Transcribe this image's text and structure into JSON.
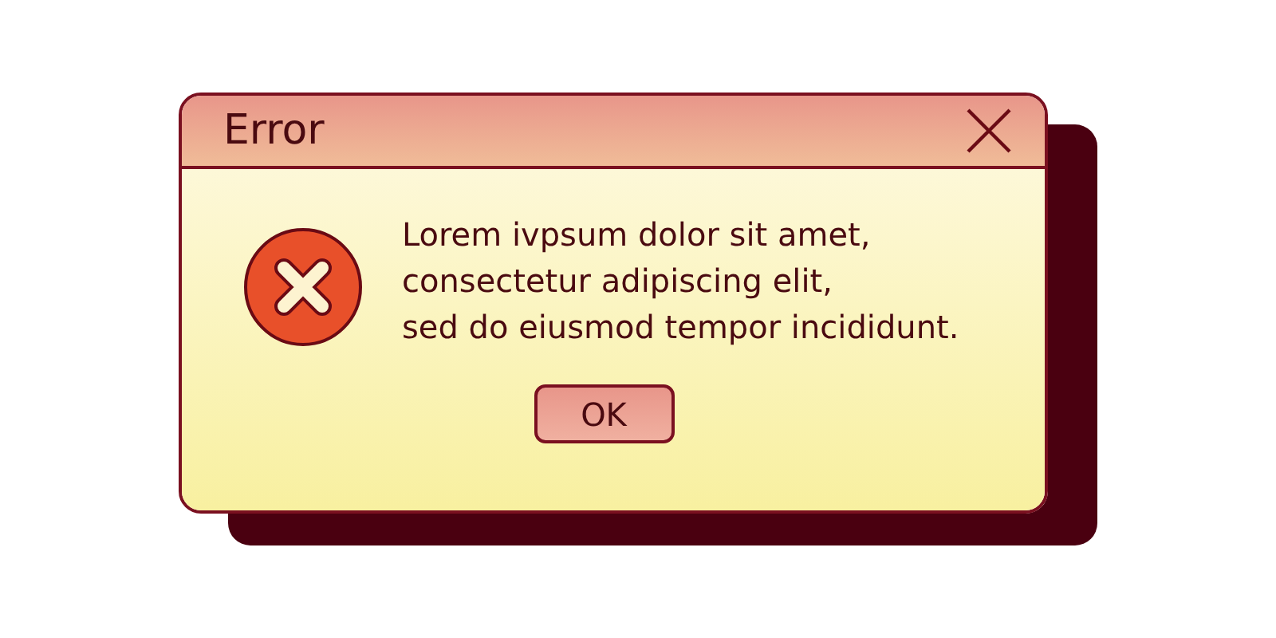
{
  "window": {
    "title": "Error"
  },
  "message": {
    "lines": [
      "Lorem ivpsum dolor sit amet,",
      "consectetur adipiscing elit,",
      "sed do eiusmod tempor incididunt."
    ]
  },
  "buttons": [
    "OK"
  ]
}
